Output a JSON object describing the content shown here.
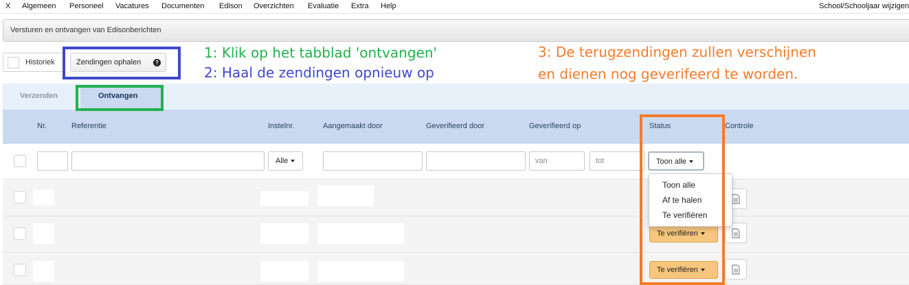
{
  "menubar": {
    "items": [
      "X",
      "Algemeen",
      "Personeel",
      "Vacatures",
      "Documenten",
      "Edison",
      "Overzichten",
      "Evaluatie",
      "Extra",
      "Help"
    ],
    "right_link": "School/Schooljaar wijzigen"
  },
  "titlebar": {
    "title": "Versturen en ontvangen van Edisonberichten"
  },
  "toolbar": {
    "historiek_label": "Historiek",
    "ophalen_label": "Zendingen ophalen",
    "help_icon": "question-circle-icon"
  },
  "annotations": {
    "step1": "1: Klik op het tabblad 'ontvangen'",
    "step2": "2: Haal de zendingen opnieuw op",
    "step3_line1": "3: De terugzendingen zullen verschijnen",
    "step3_line2": "en dienen nog geverifeerd te worden.",
    "colors": {
      "green": "#22b14c",
      "blue": "#3f48cc",
      "orange": "#f47b2a"
    }
  },
  "tabs": [
    {
      "label": "Verzenden",
      "active": false
    },
    {
      "label": "Ontvangen",
      "active": true
    }
  ],
  "table": {
    "columns": [
      "Nr.",
      "Referentie",
      "Instelnr.",
      "Aangemaakt door",
      "Geverifieerd door",
      "Geverifieerd op",
      "Status",
      "Controle"
    ],
    "filters": {
      "instelnr_select": "Alle",
      "date_from_placeholder": "van",
      "date_to_placeholder": "tot",
      "status_select": "Toon alle"
    },
    "status_options": [
      "Toon alle",
      "Af te halen",
      "Te verifiëren"
    ],
    "rows": [
      {
        "status": "",
        "controle_icon": "document-icon"
      },
      {
        "status": "Te verifiëren",
        "controle_icon": "document-icon"
      },
      {
        "status": "Te verifiëren",
        "controle_icon": "document-icon"
      }
    ]
  },
  "colors": {
    "header_bg": "#c9daf0",
    "tabbar_bg": "#e8f0f9",
    "status_button": "#f7c67e"
  }
}
